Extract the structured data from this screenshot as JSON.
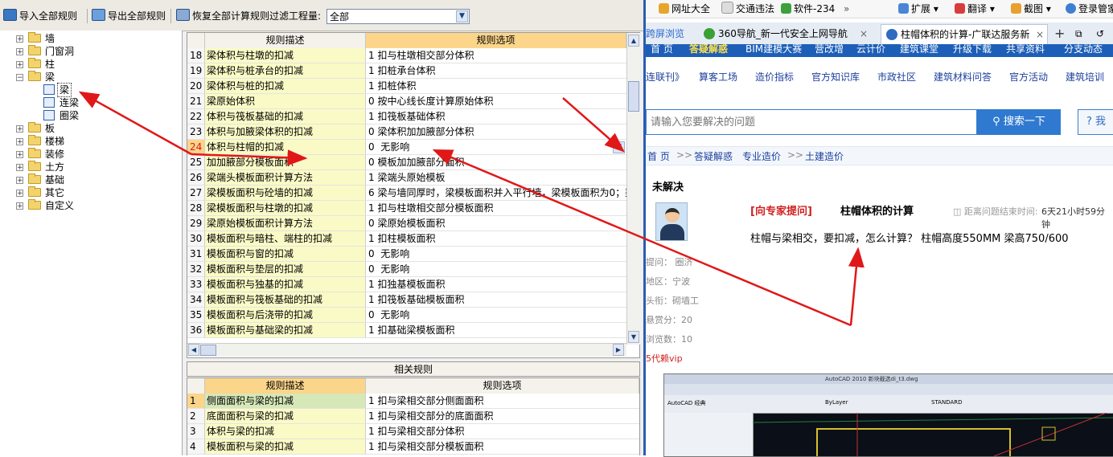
{
  "toolbar": {
    "import_all": "导入全部规则",
    "export_all": "导出全部规则",
    "restore_all": "恢复全部计算规则",
    "filter_label": "过滤工程量:",
    "filter_value": "全部"
  },
  "tree": {
    "items": [
      {
        "label": "墙",
        "expander": "+"
      },
      {
        "label": "门窗洞",
        "expander": "+"
      },
      {
        "label": "柱",
        "expander": "+"
      },
      {
        "label": "梁",
        "expander": "−"
      },
      {
        "label": "梁"
      },
      {
        "label": "连梁"
      },
      {
        "label": "圈梁"
      },
      {
        "label": "板",
        "expander": "+"
      },
      {
        "label": "楼梯",
        "expander": "+"
      },
      {
        "label": "装修",
        "expander": "+"
      },
      {
        "label": "土方",
        "expander": "+"
      },
      {
        "label": "基础",
        "expander": "+"
      },
      {
        "label": "其它",
        "expander": "+"
      },
      {
        "label": "自定义",
        "expander": "+"
      }
    ]
  },
  "rules_grid": {
    "header_desc": "规则描述",
    "header_opt": "规则选项",
    "rows": [
      {
        "no": "18",
        "desc": "梁体积与柱墩的扣减",
        "opt": "1 扣与柱墩相交部分体积"
      },
      {
        "no": "19",
        "desc": "梁体积与桩承台的扣减",
        "opt": "1 扣桩承台体积"
      },
      {
        "no": "20",
        "desc": "梁体积与桩的扣减",
        "opt": "1 扣桩体积"
      },
      {
        "no": "21",
        "desc": "梁原始体积",
        "opt": "0 按中心线长度计算原始体积"
      },
      {
        "no": "22",
        "desc": "体积与筏板基础的扣减",
        "opt": "1 扣筏板基础体积"
      },
      {
        "no": "23",
        "desc": "体积与加腋梁体积的扣减",
        "opt": "0 梁体积加加腋部分体积"
      },
      {
        "no": "24",
        "desc": "体积与柱帽的扣减",
        "opt": "0  无影响"
      },
      {
        "no": "25",
        "desc": "加加腋部分模板面积",
        "opt": "0 模板加加腋部分面积"
      },
      {
        "no": "26",
        "desc": "梁端头模板面积计算方法",
        "opt": "1 梁端头原始模板"
      },
      {
        "no": "27",
        "desc": "梁模板面积与砼墙的扣减",
        "opt": "6 梁与墙同厚时，梁模板面积并入平行墙，梁模板面积为0；梁"
      },
      {
        "no": "28",
        "desc": "梁模板面积与柱墩的扣减",
        "opt": "1 扣与柱墩相交部分模板面积"
      },
      {
        "no": "29",
        "desc": "梁原始模板面积计算方法",
        "opt": "0 梁原始模板面积"
      },
      {
        "no": "30",
        "desc": "模板面积与暗柱、端柱的扣减",
        "opt": "1 扣柱模板面积"
      },
      {
        "no": "31",
        "desc": "模板面积与窗的扣减",
        "opt": "0  无影响"
      },
      {
        "no": "32",
        "desc": "模板面积与垫层的扣减",
        "opt": "0  无影响"
      },
      {
        "no": "33",
        "desc": "模板面积与独基的扣减",
        "opt": "1 扣独基模板面积"
      },
      {
        "no": "34",
        "desc": "模板面积与筏板基础的扣减",
        "opt": "1 扣筏板基础模板面积"
      },
      {
        "no": "35",
        "desc": "模板面积与后浇带的扣减",
        "opt": "0  无影响"
      },
      {
        "no": "36",
        "desc": "模板面积与基础梁的扣减",
        "opt": "1 扣基础梁模板面积"
      }
    ]
  },
  "related": {
    "title": "相关规则",
    "header_desc": "规则描述",
    "header_opt": "规则选项",
    "rows": [
      {
        "no": "1",
        "desc": "侧面面积与梁的扣减",
        "opt": "1 扣与梁相交部分侧面面积"
      },
      {
        "no": "2",
        "desc": "底面面积与梁的扣减",
        "opt": "1 扣与梁相交部分的底面面积"
      },
      {
        "no": "3",
        "desc": "体积与梁的扣减",
        "opt": "1 扣与梁相交部分体积"
      },
      {
        "no": "4",
        "desc": "模板面积与梁的扣减",
        "opt": "1 扣与梁相交部分模板面积"
      }
    ]
  },
  "browser": {
    "bookmarks": [
      "网址大全",
      "交通违法",
      "软件-234",
      "扩展",
      "翻译",
      "截图",
      "登录管家"
    ],
    "bm_more": "»",
    "tabs": [
      "跨屏浏览",
      "360导航_新一代安全上网导航",
      "柱帽体积的计算-广联达服务新"
    ],
    "tab_close": "×",
    "tab_new": "+",
    "site_nav": [
      "首 页",
      "答疑解惑",
      "BIM建模大赛",
      "营改增",
      "云计价",
      "建筑课堂",
      "升级下载",
      "共享资料",
      "分支动态"
    ],
    "sub_nav": [
      "连联刊》",
      "算客工场",
      "造价指标",
      "官方知识库",
      "市政社区",
      "建筑材料问答",
      "官方活动",
      "建筑培训"
    ],
    "search_placeholder": "请输入您要解决的问题",
    "search_button": "搜索一下",
    "help_button": "? 我",
    "breadcrumb": [
      "首 页",
      "答疑解惑",
      "专业造价",
      "土建造价"
    ],
    "breadcrumb_sep": ">>",
    "status": "未解决",
    "ask_expert": "[向专家提问]",
    "question_title": "柱帽体积的计算",
    "countdown_label": "距离问题结束时间:",
    "countdown": "6天21小时59分钟",
    "question_body": "柱帽与梁相交，要扣减，怎么计算？ 柱帽高度550MM 梁高750/600",
    "meta": [
      "提问： 圈济",
      "地区：宁波",
      "头衔：砌墙工",
      "悬赏分：20",
      "浏览数：10"
    ],
    "vip": "5代赖vip",
    "cad_title": "AutoCAD 2010   新块截选di_t3.dwg",
    "cad_panel": "AutoCAD 经典",
    "cad_layer": "ByLayer",
    "cad_std": "STANDARD"
  },
  "colors": {
    "header_highlight": "#fbd58a",
    "desc_cell": "#fafac6",
    "annotation_arrow": "#e01818",
    "site_blue": "#1d5fb8"
  }
}
